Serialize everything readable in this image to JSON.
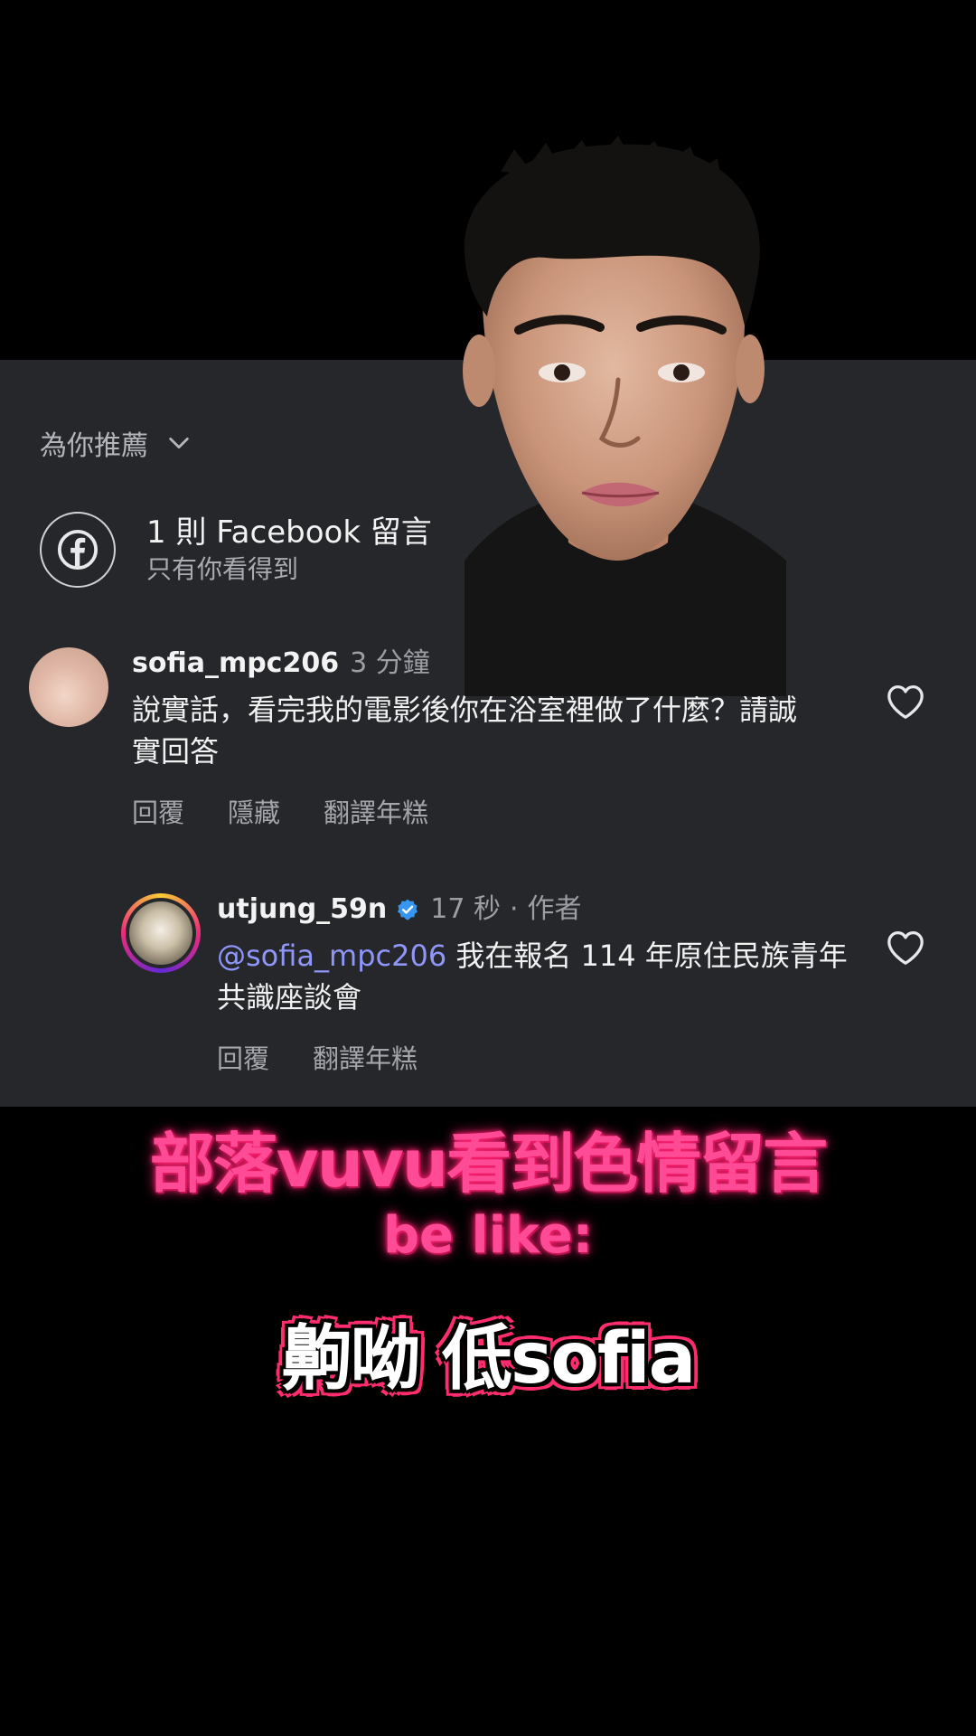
{
  "comments_panel": {
    "filter_label": "為你推薦",
    "facebook_notice": {
      "title": "1 則 Facebook 留言",
      "subtitle": "只有你看得到"
    },
    "comments": [
      {
        "username": "sofia_mpc206",
        "time": "3 分鐘",
        "text": "說實話，看完我的電影後你在浴室裡做了什麼？請誠實回答",
        "actions": [
          "回覆",
          "隱藏",
          "翻譯年糕"
        ]
      }
    ],
    "replies": [
      {
        "username": "utjung_59n",
        "time": "17 秒",
        "separator": "·",
        "author_tag": "作者",
        "mention": "@sofia_mpc206",
        "text": " 我在報名 114 年原住民族青年共識座談會",
        "actions": [
          "回覆",
          "翻譯年糕"
        ]
      }
    ]
  },
  "captions": {
    "line1": "部落vuvu看到色情留言",
    "line2": "be like:",
    "line3": "齁呦 低sofia"
  },
  "colors": {
    "panel_bg": "#25272b",
    "mention": "#8f96f8",
    "caption_pink": "#ff4b95",
    "verified_blue": "#3797f0"
  }
}
